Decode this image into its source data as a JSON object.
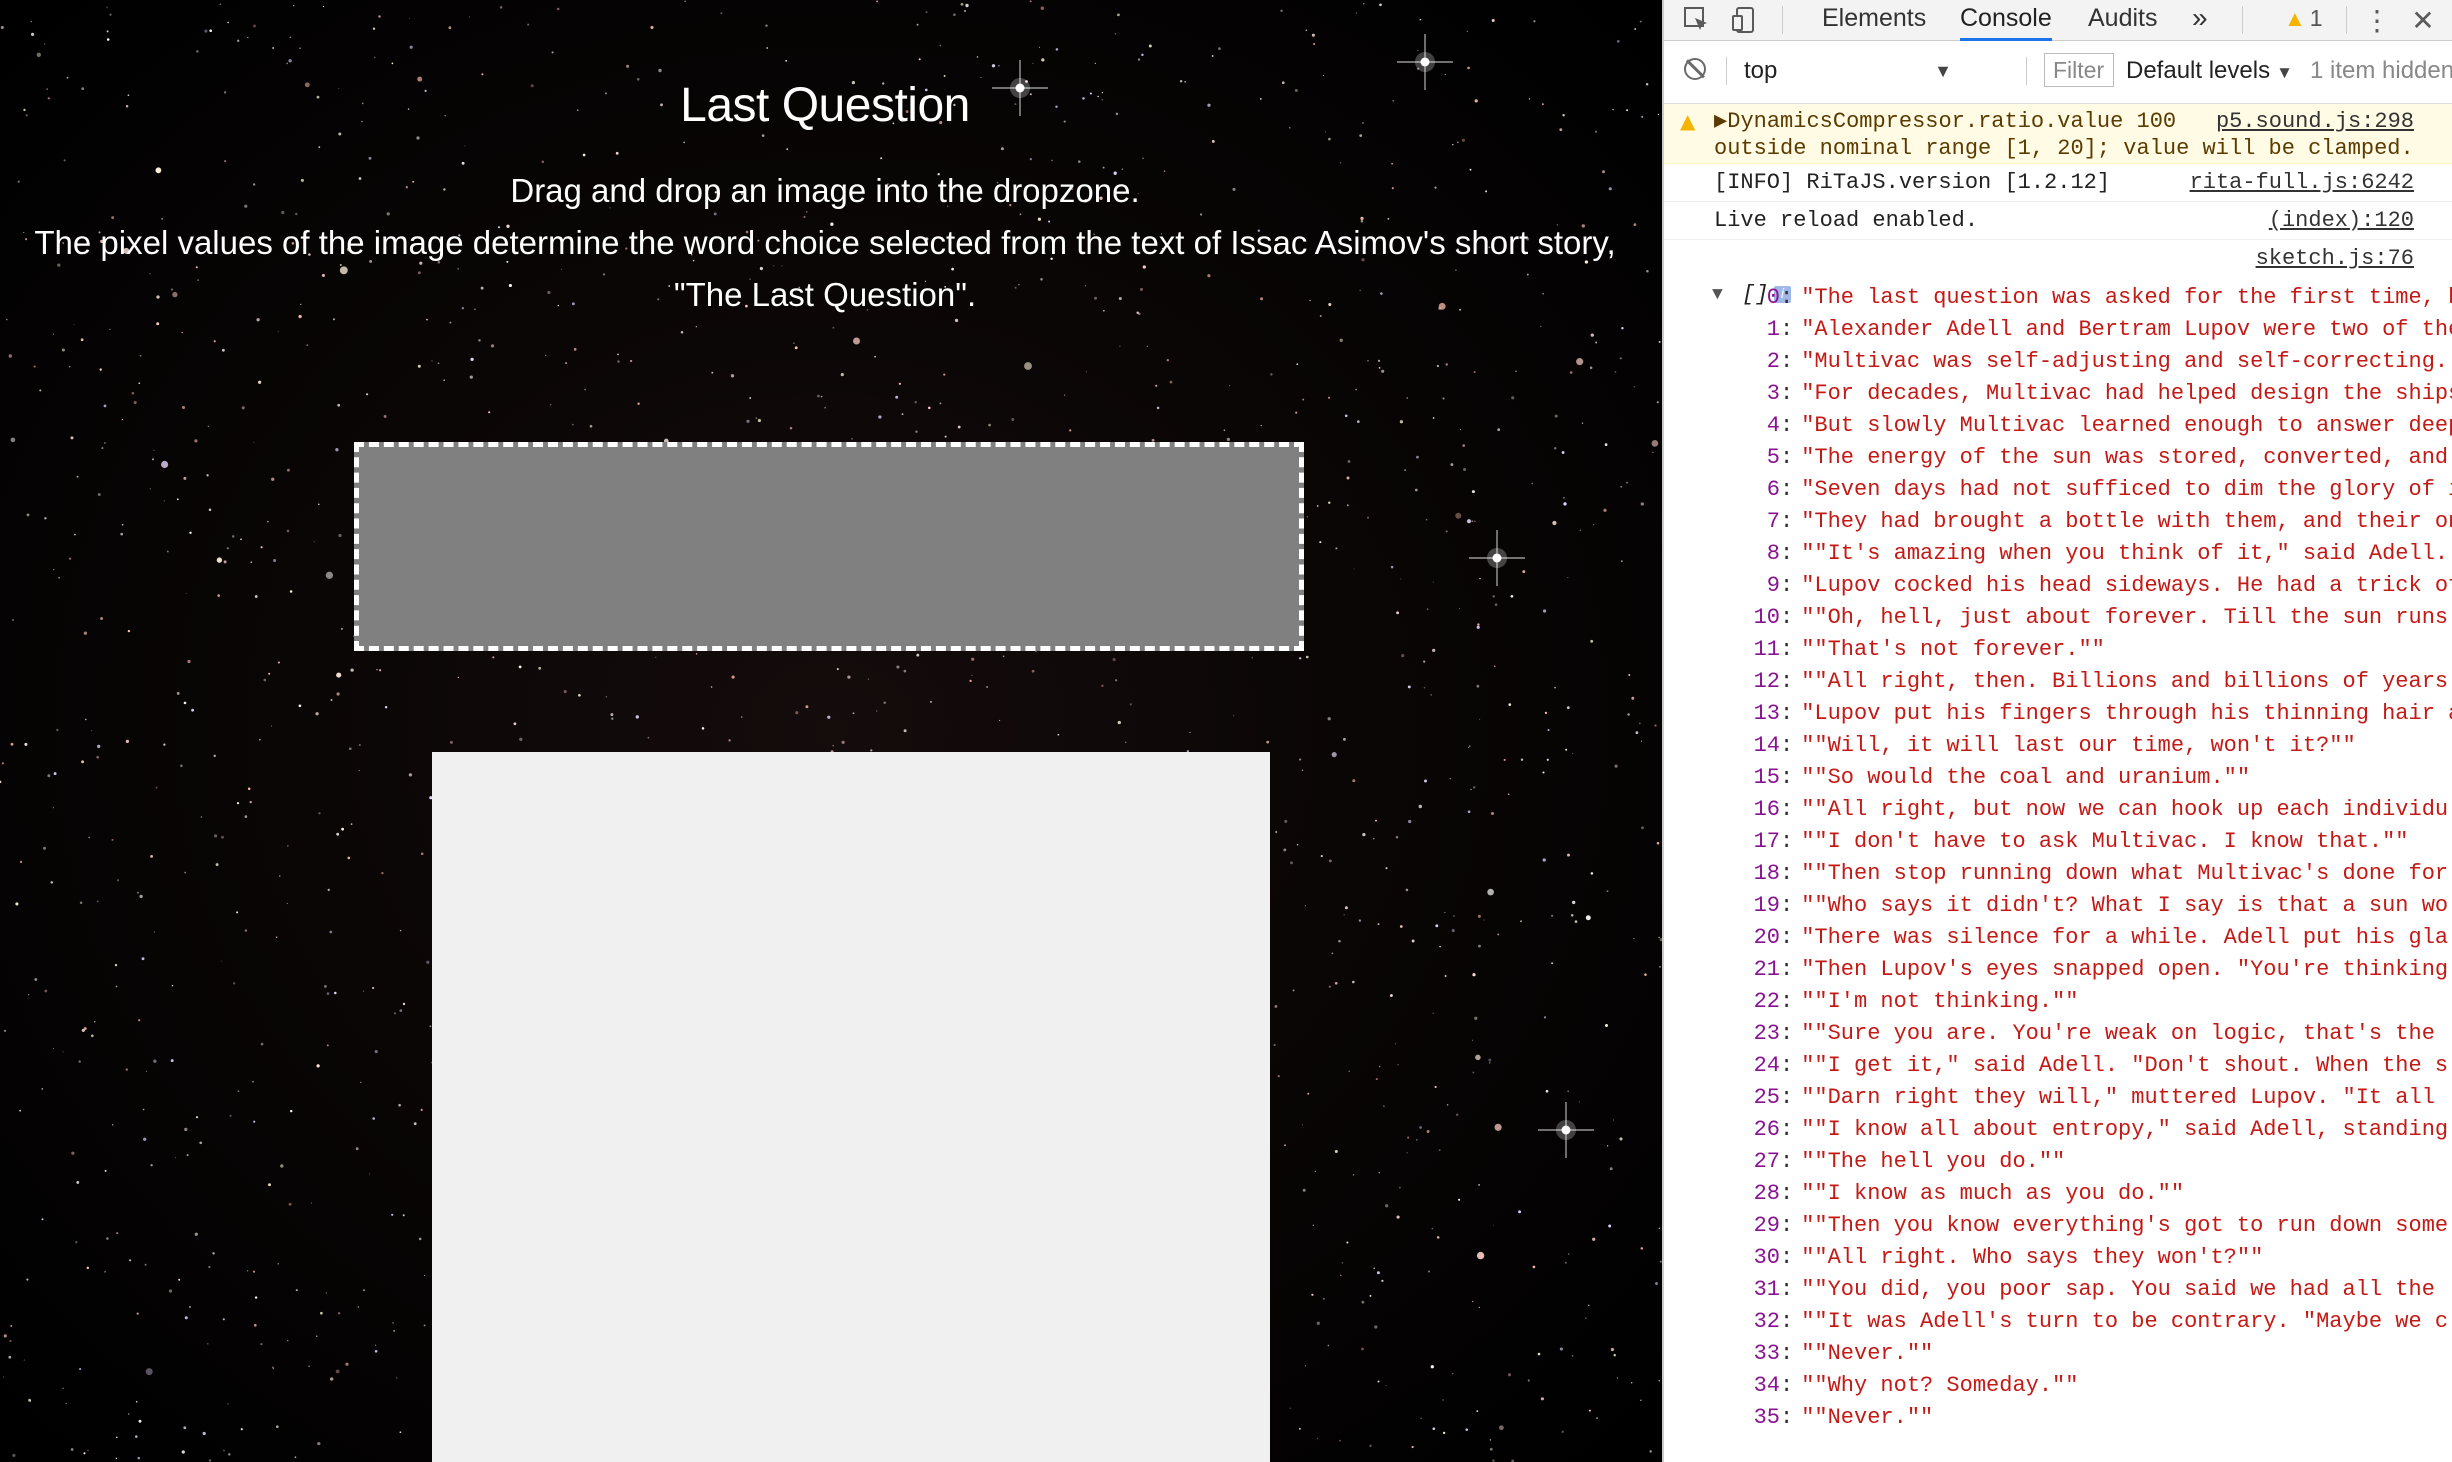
{
  "page": {
    "title": "Last Question",
    "description": [
      "Drag and drop an image into the dropzone.",
      "The pixel values of the image determine the word choice selected from the text of Issac Asimov's short story,",
      "\"The Last Question\"."
    ],
    "background_color": "#000000",
    "dropzone_color": "#808080",
    "canvas_color": "#f0f0f0"
  },
  "devtools": {
    "tabs": [
      "Elements",
      "Console",
      "Audits"
    ],
    "active_tab": "Console",
    "more_tabs_glyph": "»",
    "warning_count": "1",
    "context": "top",
    "filter_placeholder": "Filter",
    "levels": "Default levels",
    "hidden_items": "1 item hidden",
    "messages": [
      {
        "type": "warning",
        "text_line1": "▶DynamicsCompressor.ratio.value 100",
        "text_line2": "outside nominal range [1, 20]; value will be clamped.",
        "source": "p5.sound.js:298"
      },
      {
        "type": "log",
        "text": "[INFO] RiTaJS.version [1.2.12]",
        "source": "rita-full.js:6242"
      },
      {
        "type": "log",
        "text": "Live reload enabled.",
        "source": "(index):120"
      },
      {
        "type": "log",
        "text": "",
        "source": "sketch.js:76"
      }
    ],
    "array_label": "[]",
    "array_rows": [
      "\"The last question was asked for the first time, h",
      "\"Alexander Adell and Bertram Lupov were two of the",
      "\"Multivac was self-adjusting and self-correcting.",
      "\"For decades, Multivac had helped design the ships",
      "\"But slowly Multivac learned enough to answer deep",
      "\"The energy of the sun was stored, converted, and",
      "\"Seven days had not sufficed to dim the glory of i",
      "\"They had brought a bottle with them, and their on",
      "\"\"It's amazing when you think of it,\" said Adell.",
      "\"Lupov cocked his head sideways. He had a trick of",
      "\"\"Oh, hell, just about forever. Till the sun runs",
      "\"\"That's not forever.\"\"",
      "\"\"All right, then. Billions and billions of years",
      "\"Lupov put his fingers through his thinning hair a",
      "\"\"Will, it will last our time, won't it?\"\"",
      "\"\"So would the coal and uranium.\"\"",
      "\"\"All right, but now we can hook up each individu",
      "\"\"I don't have to ask Multivac. I know that.\"\"",
      "\"\"Then stop running down what Multivac's done for",
      "\"\"Who says it didn't? What I say is that a sun wo",
      "\"There was silence for a while. Adell put his gla",
      "\"Then Lupov's eyes snapped open. \"You're thinking",
      "\"\"I'm not thinking.\"\"",
      "\"\"Sure you are. You're weak on logic, that's the",
      "\"\"I get it,\" said Adell. \"Don't shout. When the s",
      "\"\"Darn right they will,\" muttered Lupov. \"It all",
      "\"\"I know all about entropy,\" said Adell, standing",
      "\"\"The hell you do.\"\"",
      "\"\"I know as much as you do.\"\"",
      "\"\"Then you know everything's got to run down some",
      "\"\"All right. Who says they won't?\"\"",
      "\"\"You did, you poor sap. You said we had all the",
      "\"\"It was Adell's turn to be contrary. \"Maybe we c",
      "\"\"Never.\"\"",
      "\"\"Why not? Someday.\"\"",
      "\"\"Never.\"\""
    ]
  }
}
